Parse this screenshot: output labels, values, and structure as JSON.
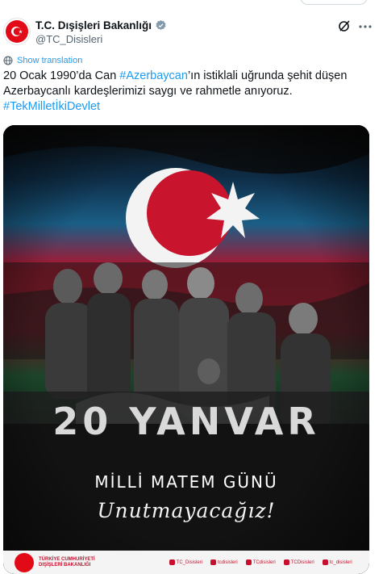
{
  "account": {
    "display_name": "T.C. Dışişleri Bakanlığı",
    "handle": "@TC_Disisleri"
  },
  "tweet": {
    "show_translation": "Show translation",
    "text_part1": "20 Ocak 1990’da Can ",
    "hashtag1": "#Azerbaycan",
    "text_part2": "’ın istiklali uğrunda şehit düşen Azerbaycanlı kardeşlerimizi saygı ve rahmetle anıyoruz.",
    "hashtag2": "#TekMilletİkiDevlet"
  },
  "poster": {
    "title": "20 YANVAR",
    "subtitle": "MİLLİ MATEM GÜNÜ",
    "script": "Unutmayacağız!",
    "org_line1": "TÜRKİYE CUMHURİYETİ",
    "org_line2": "DIŞİŞLERİ BAKANLIĞI",
    "socials": [
      {
        "icon": "x-icon",
        "label": "TC_Disisleri"
      },
      {
        "icon": "instagram-icon",
        "label": "tcdisisleri"
      },
      {
        "icon": "facebook-icon",
        "label": "TCdisisleri"
      },
      {
        "icon": "youtube-icon",
        "label": "TCDisisleri"
      },
      {
        "icon": "nsosyal-icon",
        "label": "tc_disisleri"
      }
    ]
  },
  "colors": {
    "link": "#1d9bf0",
    "flag_blue": "#00a3dd",
    "flag_red": "#e4002b",
    "flag_green": "#00b140",
    "turkey_red": "#e30a17"
  }
}
